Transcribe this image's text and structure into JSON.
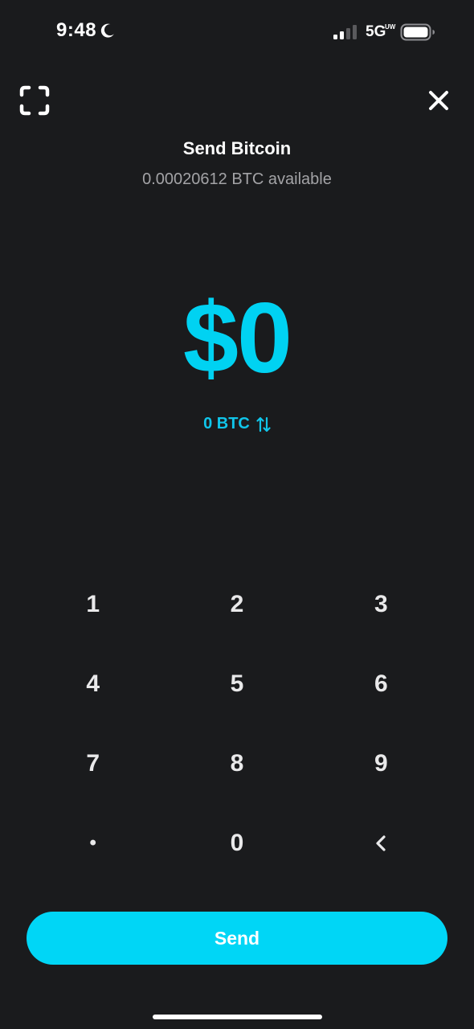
{
  "status_bar": {
    "time": "9:48",
    "network": "5G",
    "network_sup": "UW",
    "icons": [
      "moon-icon",
      "signal-icon",
      "battery-icon"
    ]
  },
  "header": {
    "title": "Send Bitcoin",
    "available": "0.00020612 BTC available",
    "icons": [
      "scan-icon",
      "close-icon"
    ]
  },
  "amount": {
    "fiat": "$0",
    "crypto": "0 BTC",
    "toggle_icon": "swap-arrows-icon"
  },
  "keypad": {
    "keys": [
      "1",
      "2",
      "3",
      "4",
      "5",
      "6",
      "7",
      "8",
      "9",
      "•",
      "0",
      "<"
    ],
    "backspace_icon": "chevron-left-icon"
  },
  "actions": {
    "send_label": "Send"
  },
  "colors": {
    "background": "#1a1b1d",
    "accent": "#00d2f2",
    "button": "#00d6f6",
    "muted_text": "#a3a3a6"
  }
}
